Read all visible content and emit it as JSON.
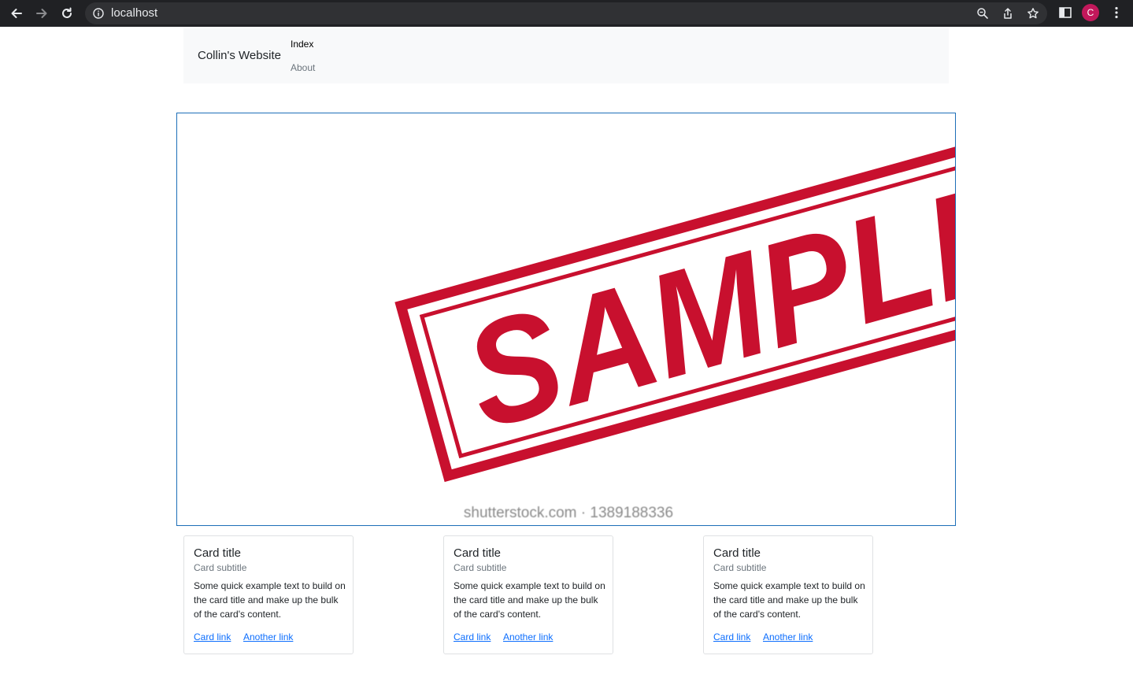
{
  "browser": {
    "url": "localhost",
    "avatar_letter": "C",
    "avatar_color": "#c2185b"
  },
  "navbar": {
    "brand": "Collin's Website",
    "links": [
      {
        "label": "Index",
        "active": true
      },
      {
        "label": "About",
        "active": false
      }
    ]
  },
  "hero": {
    "stamp_text": "SAMPLE",
    "watermark": "shutterstock.com · 1389188336",
    "stamp_color": "#c8102e"
  },
  "cards": [
    {
      "title": "Card title",
      "subtitle": "Card subtitle",
      "text": "Some quick example text to build on the card title and make up the bulk of the card's content.",
      "link1": "Card link",
      "link2": "Another link"
    },
    {
      "title": "Card title",
      "subtitle": "Card subtitle",
      "text": "Some quick example text to build on the card title and make up the bulk of the card's content.",
      "link1": "Card link",
      "link2": "Another link"
    },
    {
      "title": "Card title",
      "subtitle": "Card subtitle",
      "text": "Some quick example text to build on the card title and make up the bulk of the card's content.",
      "link1": "Card link",
      "link2": "Another link"
    }
  ],
  "colors": {
    "link": "#0d6efd",
    "navbar_bg": "#f8f9fa",
    "hero_border": "#1d6fb8"
  }
}
